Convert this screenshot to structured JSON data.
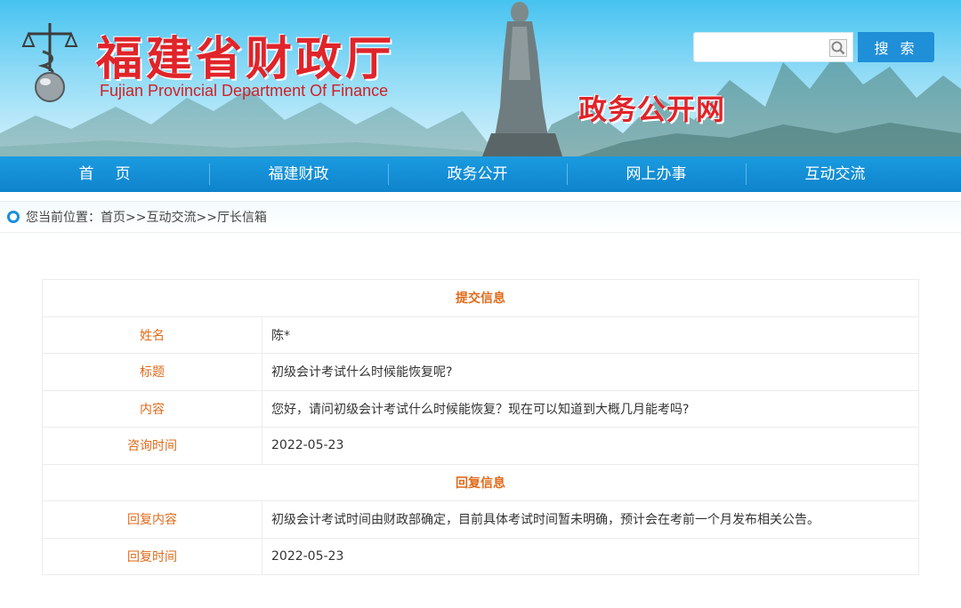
{
  "header": {
    "title_cn": "福建省财政厅",
    "title_en": "Fujian Provincial Department Of Finance",
    "site_name": "政务公开网",
    "search": {
      "placeholder": "",
      "button_label": "搜 索"
    }
  },
  "nav": {
    "items": [
      {
        "label": "首页"
      },
      {
        "label": "福建财政"
      },
      {
        "label": "政务公开"
      },
      {
        "label": "网上办事"
      },
      {
        "label": "互动交流"
      }
    ]
  },
  "breadcrumb": {
    "prefix": "您当前位置：",
    "items": [
      "首页",
      "互动交流",
      "厅长信箱"
    ],
    "separator": ">>"
  },
  "submission": {
    "heading": "提交信息",
    "rows": [
      {
        "label": "姓名",
        "value": "陈*"
      },
      {
        "label": "标题",
        "value": "初级会计考试什么时候能恢复呢?"
      },
      {
        "label": "内容",
        "value": "您好，请问初级会计考试什么时候能恢复？现在可以知道到大概几月能考吗?"
      },
      {
        "label": "咨询时间",
        "value": "2022-05-23"
      }
    ]
  },
  "reply": {
    "heading": "回复信息",
    "rows": [
      {
        "label": "回复内容",
        "value": "初级会计考试时间由财政部确定，目前具体考试时间暂未明确，预计会在考前一个月发布相关公告。"
      },
      {
        "label": "回复时间",
        "value": "2022-05-23"
      }
    ]
  },
  "colors": {
    "brand_red": "#e0242a",
    "nav_blue": "#1a9be0",
    "label_orange": "#e06a1a"
  }
}
